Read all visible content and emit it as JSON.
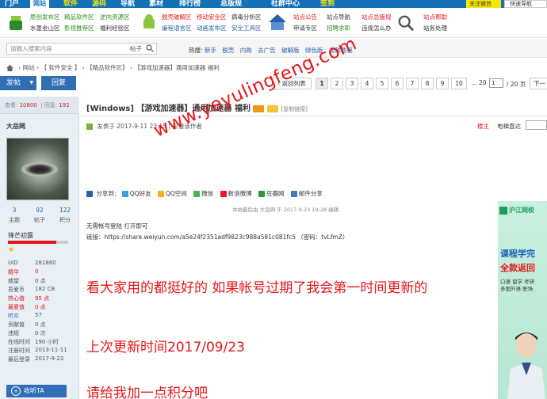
{
  "topnav": {
    "items": [
      "门户",
      "网站",
      "软件",
      "源码",
      "导航",
      "素材",
      "排行榜",
      "总版规",
      "社群中心",
      "签到"
    ],
    "right_label": "关注微信",
    "right2_label": "快速导航"
  },
  "subnav": {
    "g1": {
      "r1": [
        "原创发布区",
        "精品软件区",
        "逆向资源区"
      ],
      "r2": [
        "水墨金山区",
        "影视推荐区",
        "福利经验区"
      ]
    },
    "g2": {
      "r1": [
        "脱壳破解区",
        "移动安全区",
        "病毒分析区"
      ],
      "r2": [
        "编程语言区",
        "动画发布区",
        "安全工具区"
      ]
    },
    "g3": {
      "r1": [
        "站点公告",
        "站点导航",
        "站点总版规",
        "站点帮助"
      ],
      "r2": [
        "申请专区",
        "招聘求职",
        "违规怎么办",
        "站务处理"
      ]
    }
  },
  "search": {
    "placeholder": "请输入搜索内容",
    "scope": "帖子",
    "hot_label": "热搜:",
    "hot_words": [
      "新手",
      "脱壳",
      "内购",
      "去广告",
      "破解版",
      "绿色版",
      "视频教程"
    ]
  },
  "breadcrumb": [
    "网站",
    "【 软件安全 】",
    "【精品软件区】",
    "【游戏加速器】通用加速器 福利"
  ],
  "actions": {
    "post": "发帖",
    "reply": "回复",
    "back": "‹ 返回列表",
    "pages": [
      "1",
      "2",
      "3",
      "4",
      "5",
      "6",
      "7",
      "8",
      "9",
      "10",
      "... 20"
    ],
    "page_input": "1",
    "page_total": "/ 20 页",
    "next": "下一"
  },
  "sidebar": {
    "views_label": "查看:",
    "views": "10800",
    "replies_label": "回复:",
    "replies": "192",
    "username": "大岳网",
    "stats": [
      {
        "num": "3",
        "lbl": "主题"
      },
      {
        "num": "92",
        "lbl": "帖子"
      },
      {
        "num": "122",
        "lbl": "积分"
      }
    ],
    "rank": "锋芒初露",
    "rank_progress": 0.8,
    "profile": [
      {
        "k": "UID",
        "v": "281860",
        "style": "normal"
      },
      {
        "k": "精华",
        "v": "0",
        "style": "hl"
      },
      {
        "k": "威望",
        "v": "0 点",
        "style": "normal"
      },
      {
        "k": "吾爱币",
        "v": "182 CB",
        "style": "normal"
      },
      {
        "k": "热心值",
        "v": "95 点",
        "style": "hl"
      },
      {
        "k": "最爱值",
        "v": "0 点",
        "style": "hl"
      },
      {
        "k": "听众",
        "v": "57",
        "style": "bl"
      },
      {
        "k": "贡献值",
        "v": "0 点",
        "style": "normal"
      },
      {
        "k": "违规",
        "v": "0 次",
        "style": "normal"
      },
      {
        "k": "在线时间",
        "v": "190 小时",
        "style": "normal"
      },
      {
        "k": "注册时间",
        "v": "2013-11-11",
        "style": "normal"
      },
      {
        "k": "最后登录",
        "v": "2017-9-23",
        "style": "normal"
      }
    ],
    "listen_label": "收听TA"
  },
  "post": {
    "title": "[Windows] 【游戏加速器】通用加速器 福利",
    "copyright": "[复制链接]",
    "meta": "发表于 2017-9-11 23:15  |  只看该作者",
    "floor": "楼主",
    "e_label": "电梯直达",
    "share_label": "分享到：",
    "shares": [
      "QQ好友",
      "QQ空间",
      "微信",
      "新浪微博",
      "豆瓣网",
      "邮件分享"
    ],
    "edited": "本帖最后由 大岳网 于 2017-9-23 19:28 编辑",
    "line1": "无需帐号登陆 打开即可",
    "line2": "链接：https://share.weiyun.com/a5e24f2351adf9823c988a581c081fc5 （密码：tvLfmZ）",
    "big1": "看大家用的都挺好的 如果帐号过期了我会第一时间更新的",
    "big2": "上次更新时间2017/09/23",
    "big3": "请给我加一点积分吧"
  },
  "watermark": "www.yeyulingfeng.com",
  "ad": {
    "logo": "沪江网校",
    "t1": "课程学完",
    "t2": "全款返回",
    "t3": "口语 留学 考研",
    "t4": "多国外语 职场"
  },
  "colors": {
    "brand": "#1470b7",
    "button": "#2f6fb6",
    "red": "#e5161a",
    "green": "#2e8b24"
  }
}
